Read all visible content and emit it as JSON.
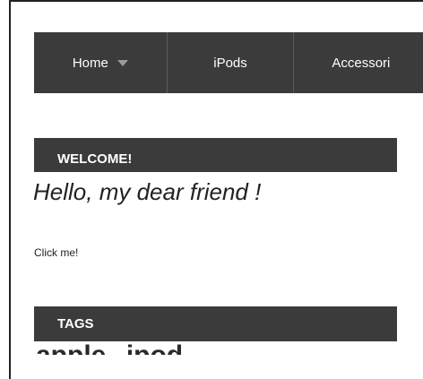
{
  "navbar": {
    "items": [
      {
        "label": "Home",
        "has_dropdown": true
      },
      {
        "label": "iPods"
      },
      {
        "label": "Accessori"
      }
    ]
  },
  "welcome": {
    "title": "WELCOME!",
    "greeting": "Hello, my dear friend !",
    "link": "Click me!"
  },
  "tags": {
    "title": "TAGS",
    "items": [
      "apple",
      "ipod"
    ]
  },
  "colors": {
    "bar": "#3b3b3b",
    "text": "#222222",
    "white": "#ffffff"
  }
}
